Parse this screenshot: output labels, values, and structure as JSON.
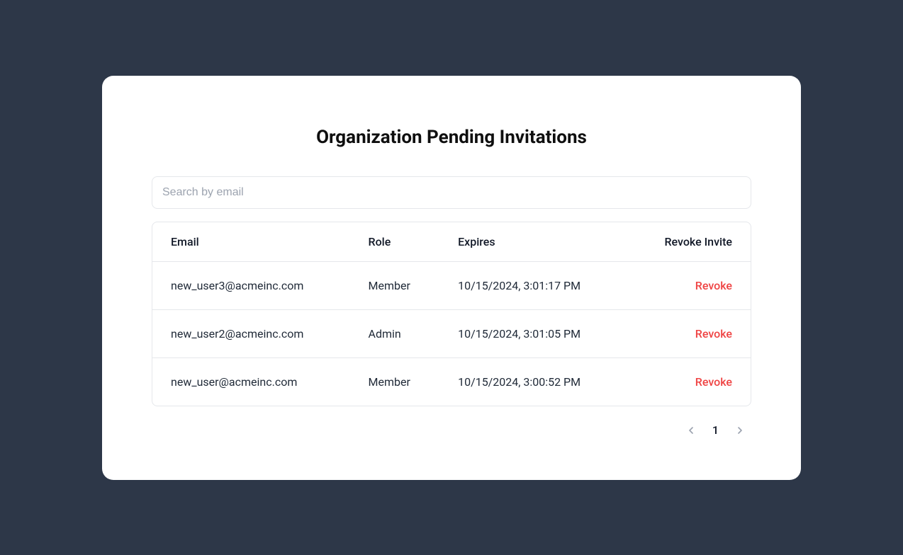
{
  "title": "Organization Pending Invitations",
  "search": {
    "placeholder": "Search by email"
  },
  "table": {
    "headers": {
      "email": "Email",
      "role": "Role",
      "expires": "Expires",
      "revoke": "Revoke Invite"
    },
    "rows": [
      {
        "email": "new_user3@acmeinc.com",
        "role": "Member",
        "expires": "10/15/2024, 3:01:17 PM",
        "revoke": "Revoke"
      },
      {
        "email": "new_user2@acmeinc.com",
        "role": "Admin",
        "expires": "10/15/2024, 3:01:05 PM",
        "revoke": "Revoke"
      },
      {
        "email": "new_user@acmeinc.com",
        "role": "Member",
        "expires": "10/15/2024, 3:00:52 PM",
        "revoke": "Revoke"
      }
    ]
  },
  "pagination": {
    "current": "1"
  }
}
